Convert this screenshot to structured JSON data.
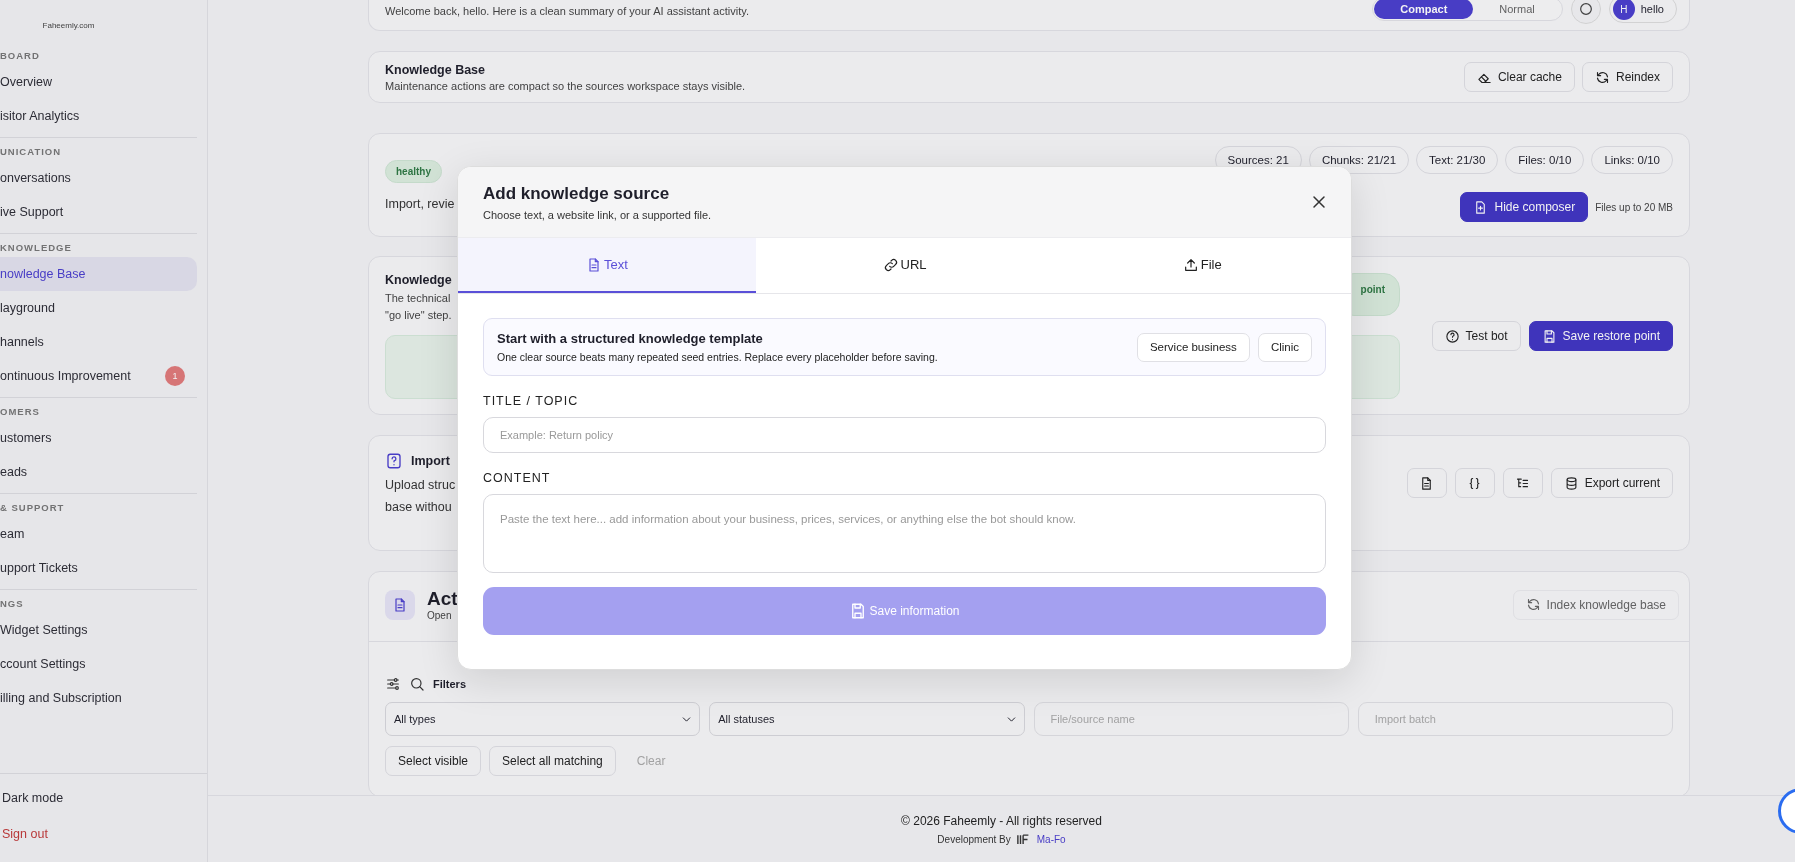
{
  "sidebar": {
    "logo_caption": "Faheemly.com",
    "sections": [
      {
        "label": "BOARD",
        "items": [
          {
            "label": "Overview",
            "selected": false
          },
          {
            "label": "isitor Analytics",
            "selected": false
          }
        ]
      },
      {
        "label": "UNICATION",
        "items": [
          {
            "label": "onversations",
            "selected": false
          },
          {
            "label": "ive Support",
            "selected": false
          }
        ]
      },
      {
        "label": "KNOWLEDGE",
        "items": [
          {
            "label": "nowledge Base",
            "selected": true
          },
          {
            "label": "layground",
            "selected": false
          },
          {
            "label": "hannels",
            "selected": false
          },
          {
            "label": "ontinuous Improvement",
            "selected": false,
            "badge": "1"
          }
        ]
      },
      {
        "label": "OMERS",
        "items": [
          {
            "label": "ustomers",
            "selected": false
          },
          {
            "label": "eads",
            "selected": false
          }
        ]
      },
      {
        "label": "& SUPPORT",
        "items": [
          {
            "label": "eam",
            "selected": false
          },
          {
            "label": "upport Tickets",
            "selected": false
          }
        ]
      },
      {
        "label": "NGS",
        "items": [
          {
            "label": "Widget Settings",
            "selected": false
          },
          {
            "label": "ccount Settings",
            "selected": false
          },
          {
            "label": "illing and Subscription",
            "selected": false
          }
        ]
      }
    ],
    "bottom_items": [
      {
        "kind": "toggle",
        "label": "Dark mode"
      },
      {
        "kind": "danger",
        "label": "Sign out"
      }
    ]
  },
  "header": {
    "welcome": "Welcome back, hello. Here is a clean summary of your AI assistant activity.",
    "density": [
      {
        "label": "Compact",
        "selected": true
      },
      {
        "label": "Normal",
        "selected": false
      }
    ],
    "user_initial": "H",
    "user_name": "hello"
  },
  "maintenance": {
    "title": "Knowledge Base",
    "subtitle": "Maintenance actions are compact so the sources workspace stays visible.",
    "buttons": [
      {
        "kind": "clear",
        "label": "Clear cache"
      },
      {
        "kind": "reindex",
        "label": "Reindex"
      }
    ]
  },
  "overview": {
    "status": "healthy",
    "description": "Import, revie",
    "stats": [
      "Sources: 21",
      "Chunks: 21/21",
      "Text: 21/30",
      "Files: 0/10",
      "Links: 0/10"
    ],
    "composer_button": "Hide composer",
    "file_limit": "Files up to 20 MB"
  },
  "restore": {
    "title": "Knowledge",
    "lines": [
      "The technical",
      "\"go live\" step."
    ],
    "badge": "point",
    "buttons": [
      {
        "kind": "test",
        "label": "Test bot"
      },
      {
        "kind": "save",
        "label": "Save restore point"
      }
    ]
  },
  "import": {
    "title": "Import",
    "lines": [
      "Upload struc",
      "base withou"
    ],
    "icon_buttons": [
      {
        "kind": "document"
      },
      {
        "kind": "braces"
      },
      {
        "kind": "list"
      }
    ],
    "export_button": "Export current"
  },
  "activity": {
    "title": "Act",
    "subtitle": "Open",
    "index_button": "Index knowledge base",
    "filters_label": "Filters",
    "type_select": "All types",
    "status_select": "All statuses",
    "name_placeholder": "File/source name",
    "batch_placeholder": "Import batch",
    "actions": [
      {
        "label": "Select visible",
        "disabled": false
      },
      {
        "label": "Select all matching",
        "disabled": false
      },
      {
        "label": "Clear",
        "disabled": true
      }
    ]
  },
  "footer": {
    "copyright": "© 2026 Faheemly - All rights reserved",
    "credit_prefix": "Development By",
    "credit_name": "Ma-Fo"
  },
  "modal": {
    "title": "Add knowledge source",
    "subtitle": "Choose text, a website link, or a supported file.",
    "tabs": [
      {
        "kind": "text",
        "label": "Text",
        "selected": true
      },
      {
        "kind": "url",
        "label": "URL",
        "selected": false
      },
      {
        "kind": "file",
        "label": "File",
        "selected": false
      }
    ],
    "template": {
      "title": "Start with a structured knowledge template",
      "description": "One clear source beats many repeated seed entries. Replace every placeholder before saving.",
      "buttons": [
        "Service business",
        "Clinic"
      ]
    },
    "title_label": "TITLE / TOPIC",
    "title_placeholder": "Example: Return policy",
    "content_label": "CONTENT",
    "content_placeholder": "Paste the text here... add information about your business, prices, services, or anything else the bot should know.",
    "save_button": "Save information",
    "save_disabled": true
  }
}
